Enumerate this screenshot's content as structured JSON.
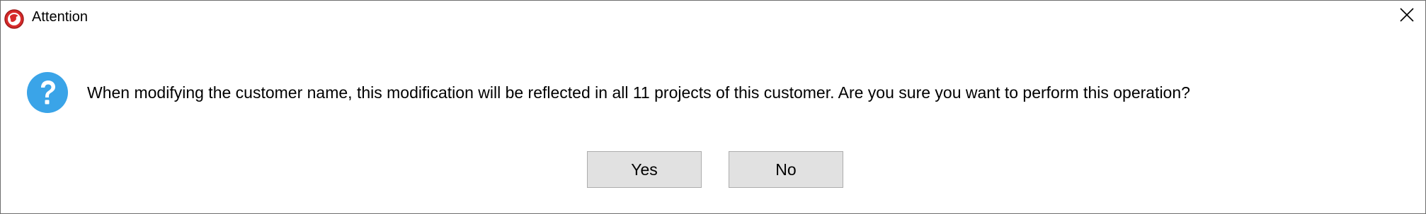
{
  "window": {
    "title": "Attention",
    "app_icon": "red-globe-app-icon",
    "close_icon": "close-x-icon"
  },
  "dialog": {
    "icon": "question-icon",
    "message": "When modifying the customer name, this modification will be reflected in all 11 projects of this customer. Are you sure you want to perform this operation?",
    "accent_color": "#3aa4e8"
  },
  "buttons": {
    "yes_label": "Yes",
    "no_label": "No"
  }
}
